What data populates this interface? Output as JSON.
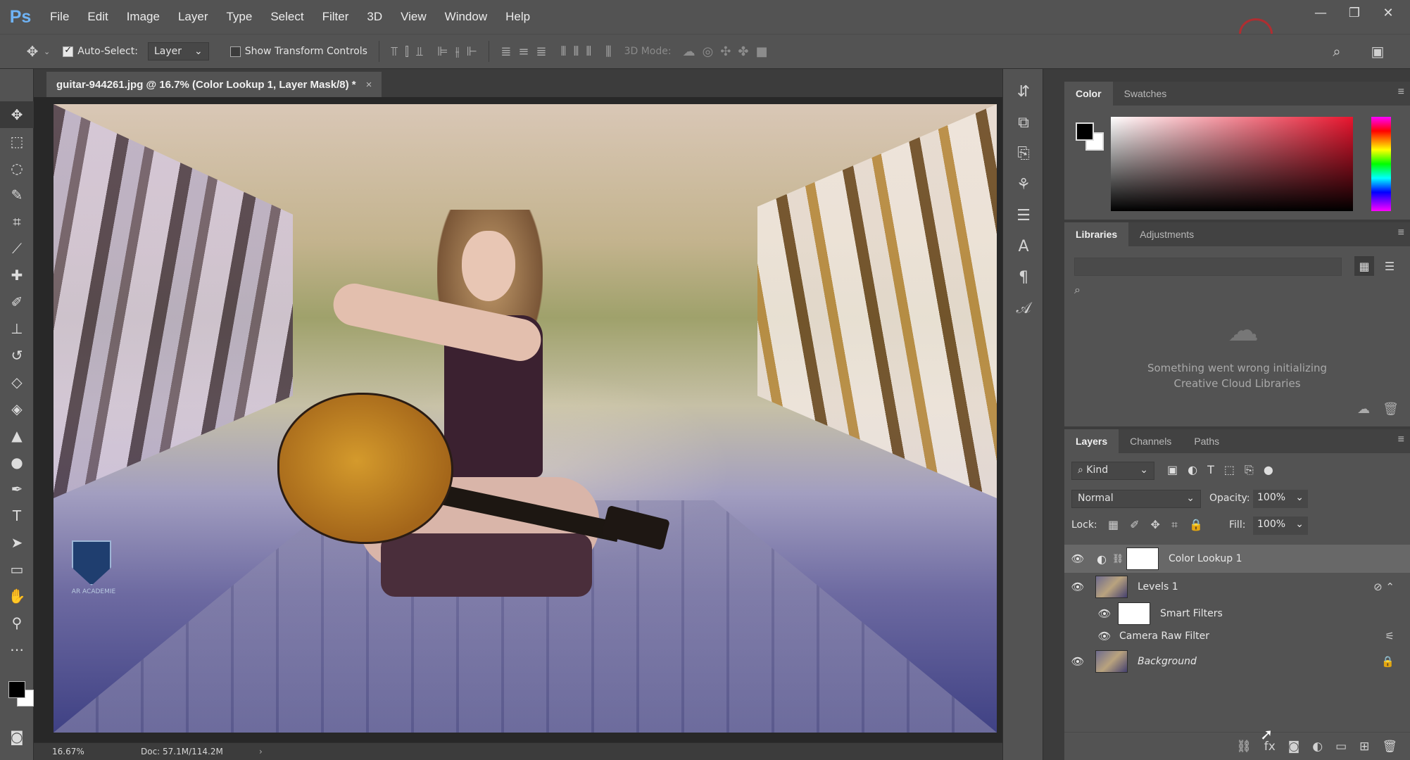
{
  "app": {
    "logo": "Ps"
  },
  "menu": [
    "File",
    "Edit",
    "Image",
    "Layer",
    "Type",
    "Select",
    "Filter",
    "3D",
    "View",
    "Window",
    "Help"
  ],
  "window_controls": [
    "minimize-icon",
    "maximize-icon",
    "close-icon"
  ],
  "options_bar": {
    "auto_select_label": "Auto-Select:",
    "auto_select_checked": true,
    "auto_select_target": "Layer",
    "show_transform_label": "Show Transform Controls",
    "show_transform_checked": false,
    "mode_3d_label": "3D Mode:"
  },
  "document": {
    "tab_title": "guitar-944261.jpg @ 16.7% (Color Lookup 1, Layer Mask/8) *",
    "close_glyph": "×",
    "zoom": "16.67%",
    "doc_info": "Doc: 57.1M/114.2M",
    "status_arrow": "›"
  },
  "watermark": {
    "text": "AR ACADEMIE"
  },
  "color_panel": {
    "tabs": [
      "Color",
      "Swatches"
    ],
    "active_tab": "Color",
    "foreground": "#000000",
    "background": "#ffffff"
  },
  "libraries_panel": {
    "tabs": [
      "Libraries",
      "Adjustments"
    ],
    "active_tab": "Libraries",
    "message_line1": "Something went wrong initializing",
    "message_line2": "Creative Cloud Libraries"
  },
  "layers_panel": {
    "tabs": [
      "Layers",
      "Channels",
      "Paths"
    ],
    "active_tab": "Layers",
    "filter_kind": "Kind",
    "blend_mode": "Normal",
    "opacity_label": "Opacity:",
    "opacity_value": "100%",
    "lock_label": "Lock:",
    "fill_label": "Fill:",
    "fill_value": "100%",
    "layers": [
      {
        "name": "Color Lookup 1",
        "selected": true
      },
      {
        "name": "Levels 1",
        "selected": false
      },
      {
        "name": "Smart Filters",
        "selected": false
      },
      {
        "name": "Camera Raw Filter",
        "selected": false
      },
      {
        "name": "Background",
        "selected": false
      }
    ]
  }
}
